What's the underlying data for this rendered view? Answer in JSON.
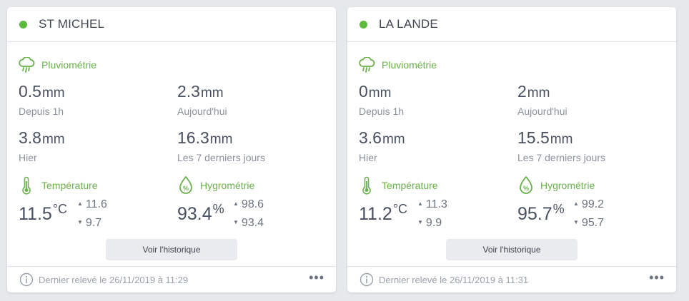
{
  "accent_color": "#6ab04c",
  "status_color": "#5cba3c",
  "stations": [
    {
      "name": "ST MICHEL",
      "status": "online",
      "rain": {
        "title": "Pluviométrie",
        "last_hour": {
          "value": "0.5",
          "unit": "mm",
          "label": "Depuis 1h"
        },
        "today": {
          "value": "2.3",
          "unit": "mm",
          "label": "Aujourd'hui"
        },
        "yesterday": {
          "value": "3.8",
          "unit": "mm",
          "label": "Hier"
        },
        "week": {
          "value": "16.3",
          "unit": "mm",
          "label": "Les 7 derniers jours"
        }
      },
      "temperature": {
        "title": "Température",
        "value": "11.5",
        "unit": "°C",
        "max": "11.6",
        "min": "9.7"
      },
      "humidity": {
        "title": "Hygrométrie",
        "value": "93.4",
        "unit": "%",
        "max": "98.6",
        "min": "93.4"
      },
      "history_button": "Voir l'historique",
      "footer": "Dernier relevé le 26/11/2019 à 11:29"
    },
    {
      "name": "LA LANDE",
      "status": "online",
      "rain": {
        "title": "Pluviométrie",
        "last_hour": {
          "value": "0",
          "unit": "mm",
          "label": "Depuis 1h"
        },
        "today": {
          "value": "2",
          "unit": "mm",
          "label": "Aujourd'hui"
        },
        "yesterday": {
          "value": "3.6",
          "unit": "mm",
          "label": "Hier"
        },
        "week": {
          "value": "15.5",
          "unit": "mm",
          "label": "Les 7 derniers jours"
        }
      },
      "temperature": {
        "title": "Température",
        "value": "11.2",
        "unit": "°C",
        "max": "11.3",
        "min": "9.9"
      },
      "humidity": {
        "title": "Hygrométrie",
        "value": "95.7",
        "unit": "%",
        "max": "99.2",
        "min": "95.7"
      },
      "history_button": "Voir l'historique",
      "footer": "Dernier relevé le 26/11/2019 à 11:31"
    }
  ]
}
